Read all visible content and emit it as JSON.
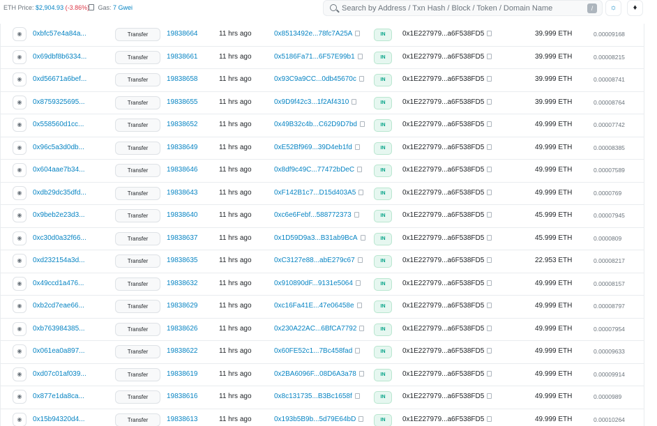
{
  "topbar": {
    "eth_price_label": "ETH Price:",
    "eth_price_value": "$2,904.93",
    "eth_price_change": "(-3.86%)",
    "gas_label": "Gas:",
    "gas_value": "7 Gwei"
  },
  "search": {
    "placeholder": "Search by Address / Txn Hash / Block / Token / Domain Name",
    "shortcut": "/"
  },
  "buttons": {
    "theme_icon": "☼",
    "eth_icon": "♦"
  },
  "rows": [
    {
      "hash": "0xbfc57e4a84a...",
      "method": "Transfer",
      "block": "19838664",
      "age": "11 hrs ago",
      "from": "0x8513492e...78fc7A25A",
      "dir": "IN",
      "to": "0x1E227979...a6F538FD5",
      "value": "39.999 ETH",
      "fee": "0.00009168"
    },
    {
      "hash": "0x69dbf8b6334...",
      "method": "Transfer",
      "block": "19838661",
      "age": "11 hrs ago",
      "from": "0x5186Fa71...6F57E99b1",
      "dir": "IN",
      "to": "0x1E227979...a6F538FD5",
      "value": "39.999 ETH",
      "fee": "0.00008215"
    },
    {
      "hash": "0xd56671a6bef...",
      "method": "Transfer",
      "block": "19838658",
      "age": "11 hrs ago",
      "from": "0x93C9a9CC...0db45670c",
      "dir": "IN",
      "to": "0x1E227979...a6F538FD5",
      "value": "39.999 ETH",
      "fee": "0.00008741"
    },
    {
      "hash": "0x8759325695...",
      "method": "Transfer",
      "block": "19838655",
      "age": "11 hrs ago",
      "from": "0x9D9f42c3...1f2Af4310",
      "dir": "IN",
      "to": "0x1E227979...a6F538FD5",
      "value": "39.999 ETH",
      "fee": "0.00008764"
    },
    {
      "hash": "0x558560d1cc...",
      "method": "Transfer",
      "block": "19838652",
      "age": "11 hrs ago",
      "from": "0x49B32c4b...C62D9D7bd",
      "dir": "IN",
      "to": "0x1E227979...a6F538FD5",
      "value": "49.999 ETH",
      "fee": "0.00007742"
    },
    {
      "hash": "0x96c5a3d0db...",
      "method": "Transfer",
      "block": "19838649",
      "age": "11 hrs ago",
      "from": "0xE52Bf969...39D4eb1fd",
      "dir": "IN",
      "to": "0x1E227979...a6F538FD5",
      "value": "49.999 ETH",
      "fee": "0.00008385"
    },
    {
      "hash": "0x604aae7b34...",
      "method": "Transfer",
      "block": "19838646",
      "age": "11 hrs ago",
      "from": "0x8df9c49C...77472bDeC",
      "dir": "IN",
      "to": "0x1E227979...a6F538FD5",
      "value": "49.999 ETH",
      "fee": "0.00007589"
    },
    {
      "hash": "0xdb29dc35dfd...",
      "method": "Transfer",
      "block": "19838643",
      "age": "11 hrs ago",
      "from": "0xF142B1c7...D15d403A5",
      "dir": "IN",
      "to": "0x1E227979...a6F538FD5",
      "value": "49.999 ETH",
      "fee": "0.0000769"
    },
    {
      "hash": "0x9beb2e23d3...",
      "method": "Transfer",
      "block": "19838640",
      "age": "11 hrs ago",
      "from": "0xc6e6Febf...588772373",
      "dir": "IN",
      "to": "0x1E227979...a6F538FD5",
      "value": "45.999 ETH",
      "fee": "0.00007945"
    },
    {
      "hash": "0xc30d0a32f66...",
      "method": "Transfer",
      "block": "19838637",
      "age": "11 hrs ago",
      "from": "0x1D59D9a3...B31ab9BcA",
      "dir": "IN",
      "to": "0x1E227979...a6F538FD5",
      "value": "45.999 ETH",
      "fee": "0.0000809"
    },
    {
      "hash": "0xd232154a3d...",
      "method": "Transfer",
      "block": "19838635",
      "age": "11 hrs ago",
      "from": "0xC3127e88...abE279c67",
      "dir": "IN",
      "to": "0x1E227979...a6F538FD5",
      "value": "22.953 ETH",
      "fee": "0.00008217"
    },
    {
      "hash": "0x49ccd1a476...",
      "method": "Transfer",
      "block": "19838632",
      "age": "11 hrs ago",
      "from": "0x910890dF...9131e5064",
      "dir": "IN",
      "to": "0x1E227979...a6F538FD5",
      "value": "49.999 ETH",
      "fee": "0.00008157"
    },
    {
      "hash": "0xb2cd7eae66...",
      "method": "Transfer",
      "block": "19838629",
      "age": "11 hrs ago",
      "from": "0xc16Fa41E...47e06458e",
      "dir": "IN",
      "to": "0x1E227979...a6F538FD5",
      "value": "49.999 ETH",
      "fee": "0.00008797"
    },
    {
      "hash": "0xb763984385...",
      "method": "Transfer",
      "block": "19838626",
      "age": "11 hrs ago",
      "from": "0x230A22AC...6BfCA7792",
      "dir": "IN",
      "to": "0x1E227979...a6F538FD5",
      "value": "49.999 ETH",
      "fee": "0.00007954"
    },
    {
      "hash": "0x061ea0a897...",
      "method": "Transfer",
      "block": "19838622",
      "age": "11 hrs ago",
      "from": "0x60FE52c1...7Bc458fad",
      "dir": "IN",
      "to": "0x1E227979...a6F538FD5",
      "value": "49.999 ETH",
      "fee": "0.00009633"
    },
    {
      "hash": "0xd07c01af039...",
      "method": "Transfer",
      "block": "19838619",
      "age": "11 hrs ago",
      "from": "0x2BA6096F...08D6A3a78",
      "dir": "IN",
      "to": "0x1E227979...a6F538FD5",
      "value": "49.999 ETH",
      "fee": "0.00009914"
    },
    {
      "hash": "0x877e1da8ca...",
      "method": "Transfer",
      "block": "19838616",
      "age": "11 hrs ago",
      "from": "0x8c131735...B3Bc1658f",
      "dir": "IN",
      "to": "0x1E227979...a6F538FD5",
      "value": "49.999 ETH",
      "fee": "0.0000989"
    },
    {
      "hash": "0x15b94320d4...",
      "method": "Transfer",
      "block": "19838613",
      "age": "11 hrs ago",
      "from": "0x193b5B9b...5d79E64bD",
      "dir": "IN",
      "to": "0x1E227979...a6F538FD5",
      "value": "49.999 ETH",
      "fee": "0.00010264"
    }
  ],
  "colors": {
    "link": "#0784c3",
    "negative": "#dc3545",
    "in_badge": "#00a186"
  },
  "icons": {
    "eye": "eye-icon",
    "copy": "copy-icon",
    "search": "search-icon",
    "gas": "gas-pump-icon",
    "theme": "sun-icon",
    "network": "ethereum-icon"
  }
}
